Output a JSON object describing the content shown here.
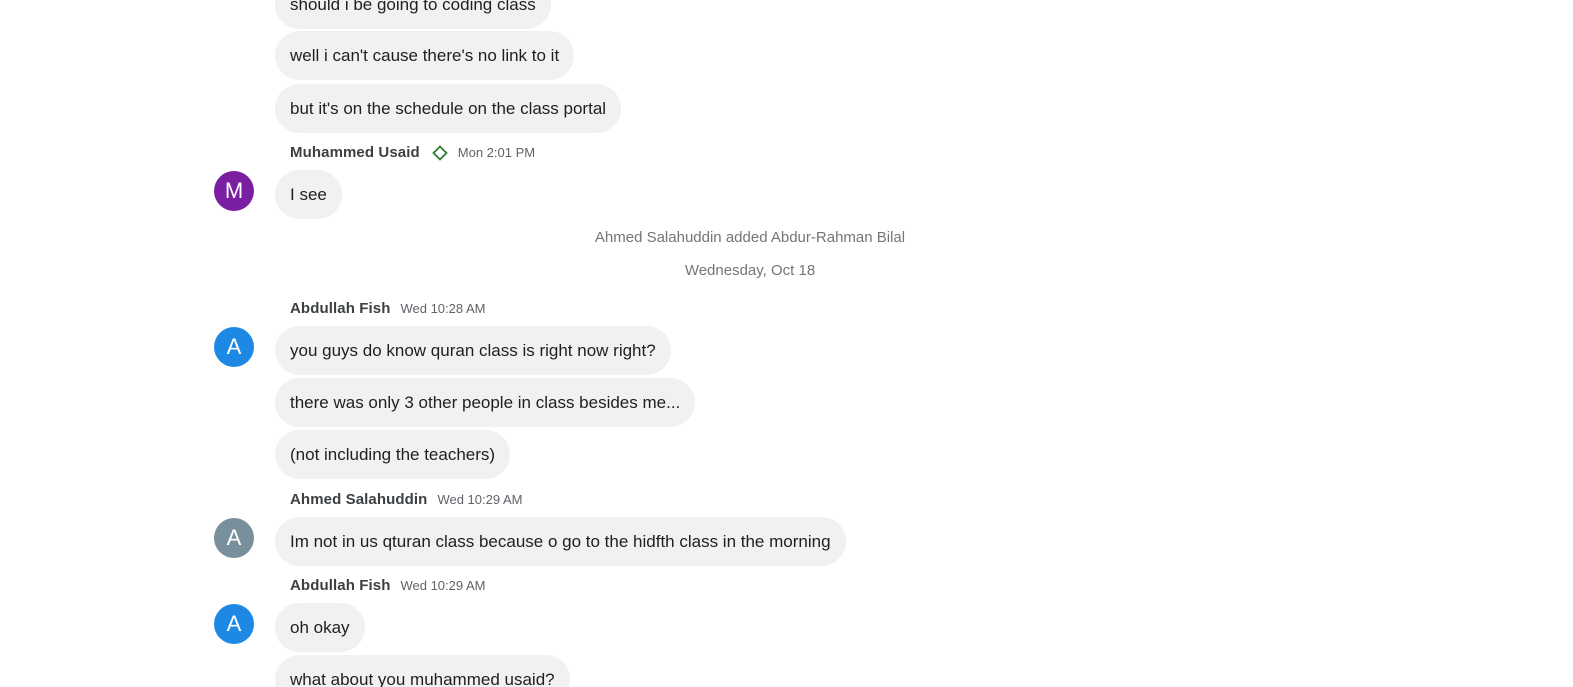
{
  "colors": {
    "avatar_purple": "#7b1fa2",
    "avatar_blue": "#1e88e5",
    "avatar_grey": "#78909c",
    "badge_green": "#2e7d32",
    "bubble_bg": "#f1f1f1"
  },
  "messages_top": [
    "should i be going to coding class",
    "well i can't cause there's no link to it",
    "but it's on the schedule on the class portal"
  ],
  "group_usaid": {
    "sender": "Muhammed Usaid",
    "badge_icon": "diamond-outline-icon",
    "time": "Mon 2:01 PM",
    "avatar_letter": "M",
    "messages": [
      "I see"
    ]
  },
  "system": {
    "added_notice": "Ahmed Salahuddin added Abdur-Rahman Bilal",
    "date_divider": "Wednesday, Oct 18"
  },
  "group_fish_1": {
    "sender": "Abdullah Fish",
    "time": "Wed 10:28 AM",
    "avatar_letter": "A",
    "messages": [
      "you guys do know quran class is right now right?",
      "there was only 3 other people in class besides me...",
      "(not including the teachers)"
    ]
  },
  "group_ahmed": {
    "sender": "Ahmed Salahuddin",
    "time": "Wed 10:29 AM",
    "avatar_letter": "A",
    "messages": [
      "Im not in us qturan class because o go to the hidfth class in the morning"
    ]
  },
  "group_fish_2": {
    "sender": "Abdullah Fish",
    "time": "Wed 10:29 AM",
    "avatar_letter": "A",
    "messages": [
      "oh okay",
      "what about you muhammed usaid?"
    ]
  }
}
